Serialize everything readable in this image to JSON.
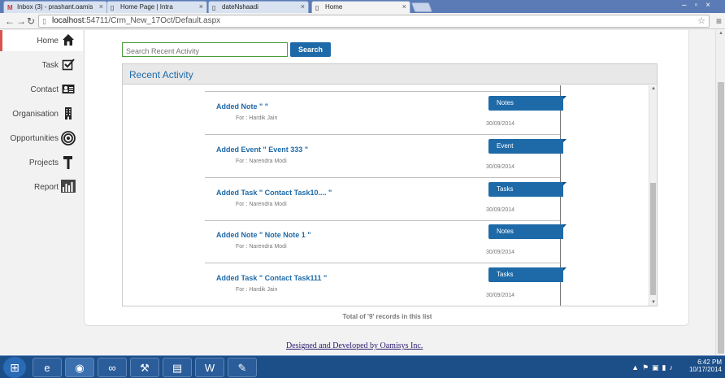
{
  "browser": {
    "tabs": [
      {
        "title": "Inbox (3) - prashant.oamis",
        "icon": "gmail-icon",
        "active": false
      },
      {
        "title": "Home Page | Intra",
        "icon": "page-icon",
        "active": false
      },
      {
        "title": "dateNshaadi",
        "icon": "page-icon",
        "active": false
      },
      {
        "title": "Home",
        "icon": "page-icon",
        "active": true
      }
    ],
    "url_host": "localhost",
    "url_path": ":54711/Crm_New_17Oct/Default.aspx"
  },
  "sidebar": {
    "items": [
      {
        "label": "Home",
        "icon": "house-icon",
        "active": true
      },
      {
        "label": "Task",
        "icon": "checkbox-icon",
        "active": false
      },
      {
        "label": "Contact",
        "icon": "contact-card-icon",
        "active": false
      },
      {
        "label": "Organisation",
        "icon": "building-icon",
        "active": false
      },
      {
        "label": "Opportunities",
        "icon": "target-icon",
        "active": false
      },
      {
        "label": "Projects",
        "icon": "hammer-icon",
        "active": false
      },
      {
        "label": "Report",
        "icon": "bar-chart-icon",
        "active": false
      }
    ]
  },
  "search": {
    "placeholder": "Search Recent Activity",
    "button_label": "Search"
  },
  "panel": {
    "title": "Recent Activity",
    "activities": [
      {
        "title": "Added Note \" \"",
        "for": "For : Hardik Jain",
        "date": "30/09/2014",
        "badge": "Notes"
      },
      {
        "title": "Added Event \" Event 333 \"",
        "for": "For : Narendra Modi",
        "date": "30/09/2014",
        "badge": "Event"
      },
      {
        "title": "Added Task \" Contact Task10.... \"",
        "for": "For : Narendra Modi",
        "date": "30/09/2014",
        "badge": "Tasks"
      },
      {
        "title": "Added Note \" Note Note 1 \"",
        "for": "For : Narendra Modi",
        "date": "30/09/2014",
        "badge": "Notes"
      },
      {
        "title": "Added Task \" Contact Task111 \"",
        "for": "For : Hardik Jain",
        "date": "30/09/2014",
        "badge": "Tasks"
      }
    ],
    "records_text": "Total of '9' records in this list"
  },
  "footer": {
    "link_text": "Designed and Developed by Oamisys Inc."
  },
  "taskbar": {
    "time": "6:42 PM",
    "date": "10/17/2014"
  },
  "colors": {
    "accent": "#1e6aa8",
    "active_marker": "#d9534f"
  }
}
